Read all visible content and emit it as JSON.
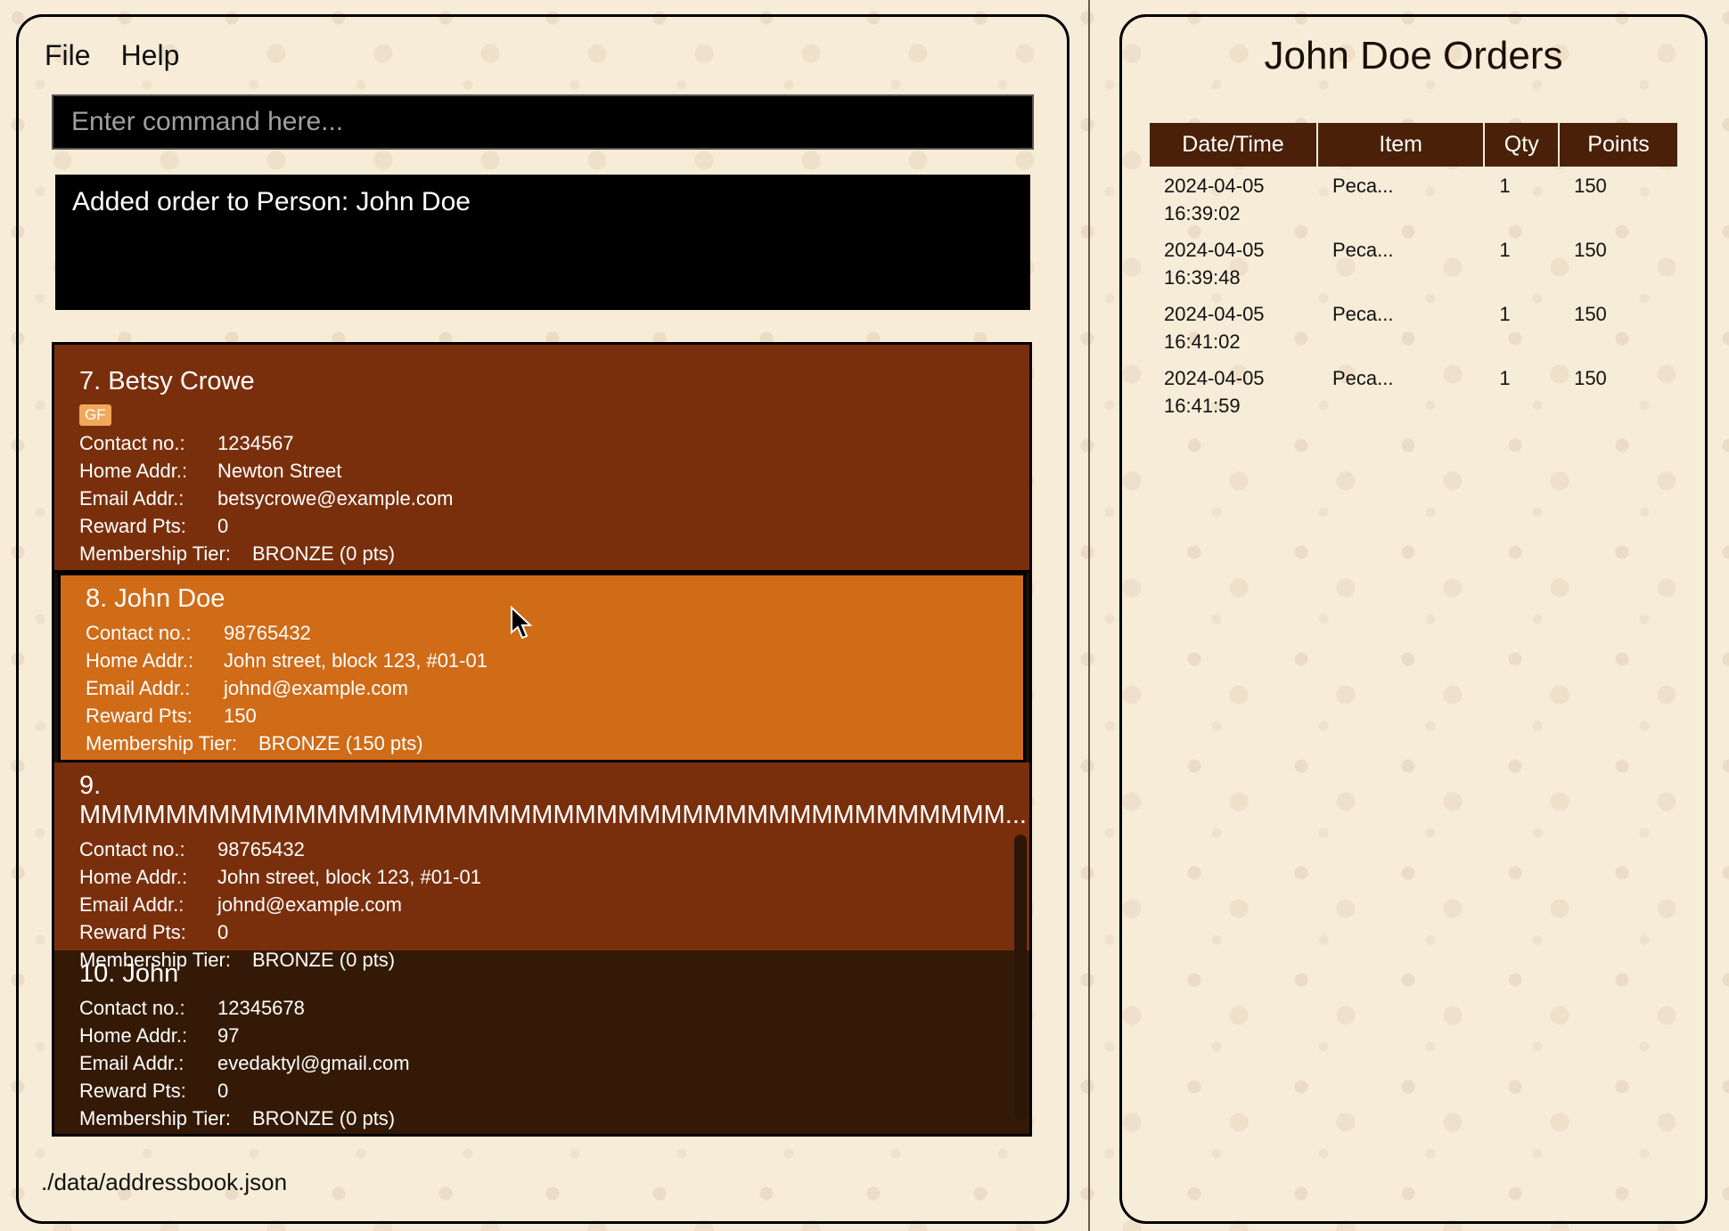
{
  "menu": {
    "file": "File",
    "help": "Help"
  },
  "command": {
    "placeholder": "Enter command here..."
  },
  "result": {
    "message": "Added order to Person: John Doe"
  },
  "labels": {
    "contact": "Contact no.:",
    "home": "Home Addr.:",
    "email": "Email Addr.:",
    "reward": "Reward Pts:",
    "tier": "Membership Tier:"
  },
  "persons": [
    {
      "title": "7.  Betsy Crowe",
      "tag": "GF",
      "contact": "1234567",
      "home": "Newton Street",
      "email": "betsycrowe@example.com",
      "reward": "0",
      "tier": "BRONZE (0 pts)"
    },
    {
      "title": "8.  John Doe",
      "contact": "98765432",
      "home": "John street, block 123, #01-01",
      "email": "johnd@example.com",
      "reward": "150",
      "tier": "BRONZE (150 pts)"
    },
    {
      "title": "9.  MMMMMMMMMMMMMMMMMMMMMMMMMMMMMMMMMMMMMMMMMMM...",
      "contact": "98765432",
      "home": "John street, block 123, #01-01",
      "email": "johnd@example.com",
      "reward": "0",
      "tier": "BRONZE (0 pts)"
    },
    {
      "title": "10.  John",
      "contact": "12345678",
      "home": "97",
      "email": "evedaktyl@gmail.com",
      "reward": "0",
      "tier": "BRONZE (0 pts)"
    }
  ],
  "status": {
    "path": "./data/addressbook.json"
  },
  "orders": {
    "title": "John Doe Orders",
    "headers": [
      "Date/Time",
      "Item",
      "Qty",
      "Points"
    ],
    "rows": [
      {
        "date": "2024-04-05",
        "time": "16:39:02",
        "item": "Peca...",
        "qty": "1",
        "points": "150"
      },
      {
        "date": "2024-04-05",
        "time": "16:39:48",
        "item": "Peca...",
        "qty": "1",
        "points": "150"
      },
      {
        "date": "2024-04-05",
        "time": "16:41:02",
        "item": "Peca...",
        "qty": "1",
        "points": "150"
      },
      {
        "date": "2024-04-05",
        "time": "16:41:59",
        "item": "Peca...",
        "qty": "1",
        "points": "150"
      }
    ]
  }
}
